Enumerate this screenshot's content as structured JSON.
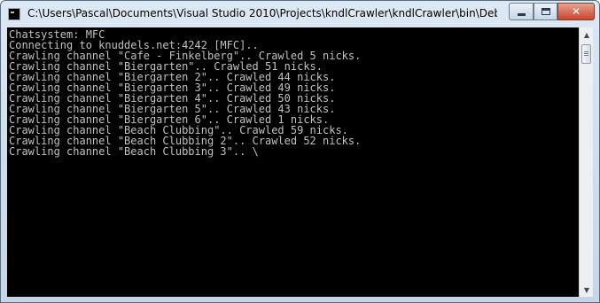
{
  "window": {
    "title": "C:\\Users\\Pascal\\Documents\\Visual Studio 2010\\Projects\\kndlCrawler\\kndlCrawler\\bin\\Debug\\kndl...",
    "controls": {
      "minimize": "minimize-icon",
      "maximize": "maximize-icon",
      "close_label": "✕"
    }
  },
  "console": {
    "lines": [
      "Chatsystem: MFC",
      "Connecting to knuddels.net:4242 [MFC]..",
      "Crawling channel \"Cafe - Finkelberg\".. Crawled 5 nicks.",
      "Crawling channel \"Biergarten\".. Crawled 51 nicks.",
      "Crawling channel \"Biergarten 2\".. Crawled 44 nicks.",
      "Crawling channel \"Biergarten 3\".. Crawled 49 nicks.",
      "Crawling channel \"Biergarten 4\".. Crawled 50 nicks.",
      "Crawling channel \"Biergarten 5\".. Crawled 43 nicks.",
      "Crawling channel \"Biergarten 6\".. Crawled 1 nicks.",
      "Crawling channel \"Beach Clubbing\".. Crawled 59 nicks.",
      "Crawling channel \"Beach Clubbing 2\".. Crawled 52 nicks.",
      "Crawling channel \"Beach Clubbing 3\".. \\"
    ]
  },
  "scrollbar": {
    "up_arrow": "▲",
    "down_arrow": "▼"
  }
}
